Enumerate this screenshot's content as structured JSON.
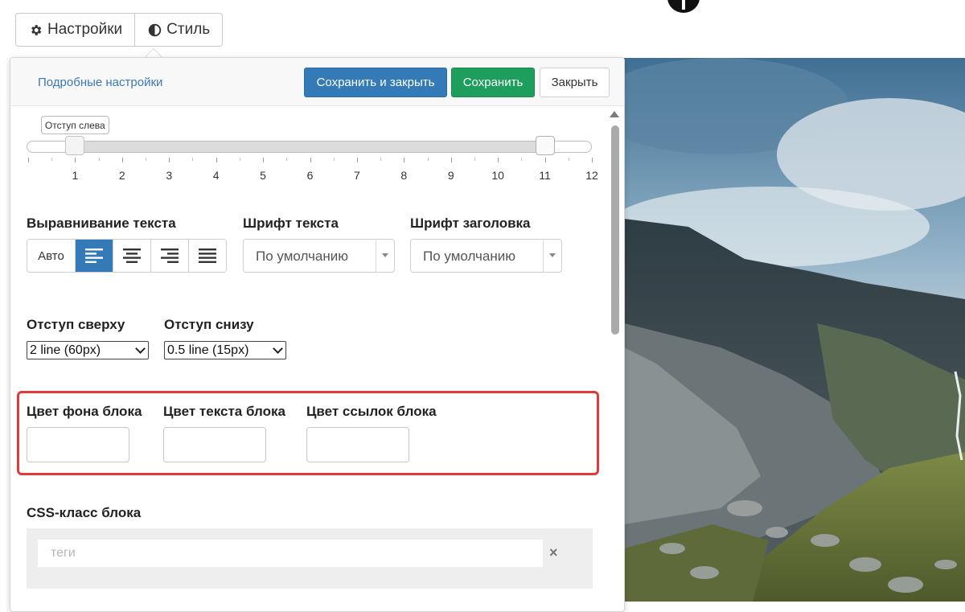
{
  "tabs": [
    {
      "label": "Настройки",
      "icon": "gear-icon"
    },
    {
      "label": "Стиль",
      "icon": "contrast-icon"
    }
  ],
  "header": {
    "advanced_link": "Подробные настройки",
    "save_close": "Сохранить и закрыть",
    "save": "Сохранить",
    "close": "Закрыть"
  },
  "slider": {
    "tooltip": "Отступ слева",
    "ticks": [
      "1",
      "2",
      "3",
      "4",
      "5",
      "6",
      "7",
      "8",
      "9",
      "10",
      "11",
      "12"
    ],
    "left_value": 1,
    "right_value": 11
  },
  "text_align": {
    "label": "Выравнивание текста",
    "auto_label": "Авто",
    "selected": "left"
  },
  "text_font": {
    "label": "Шрифт текста",
    "value": "По умолчанию"
  },
  "heading_font": {
    "label": "Шрифт заголовка",
    "value": "По умолчанию"
  },
  "padding_top": {
    "label": "Отступ сверху",
    "value": "2 line (60px)"
  },
  "padding_bottom": {
    "label": "Отступ снизу",
    "value": "0.5 line (15px)"
  },
  "colors": {
    "bg_label": "Цвет фона блока",
    "text_label": "Цвет текста блока",
    "link_label": "Цвет ссылок блока",
    "highlight_color": "#e03a3a"
  },
  "css_class": {
    "label": "CSS-класс блока",
    "placeholder": "теги",
    "clear": "×"
  }
}
